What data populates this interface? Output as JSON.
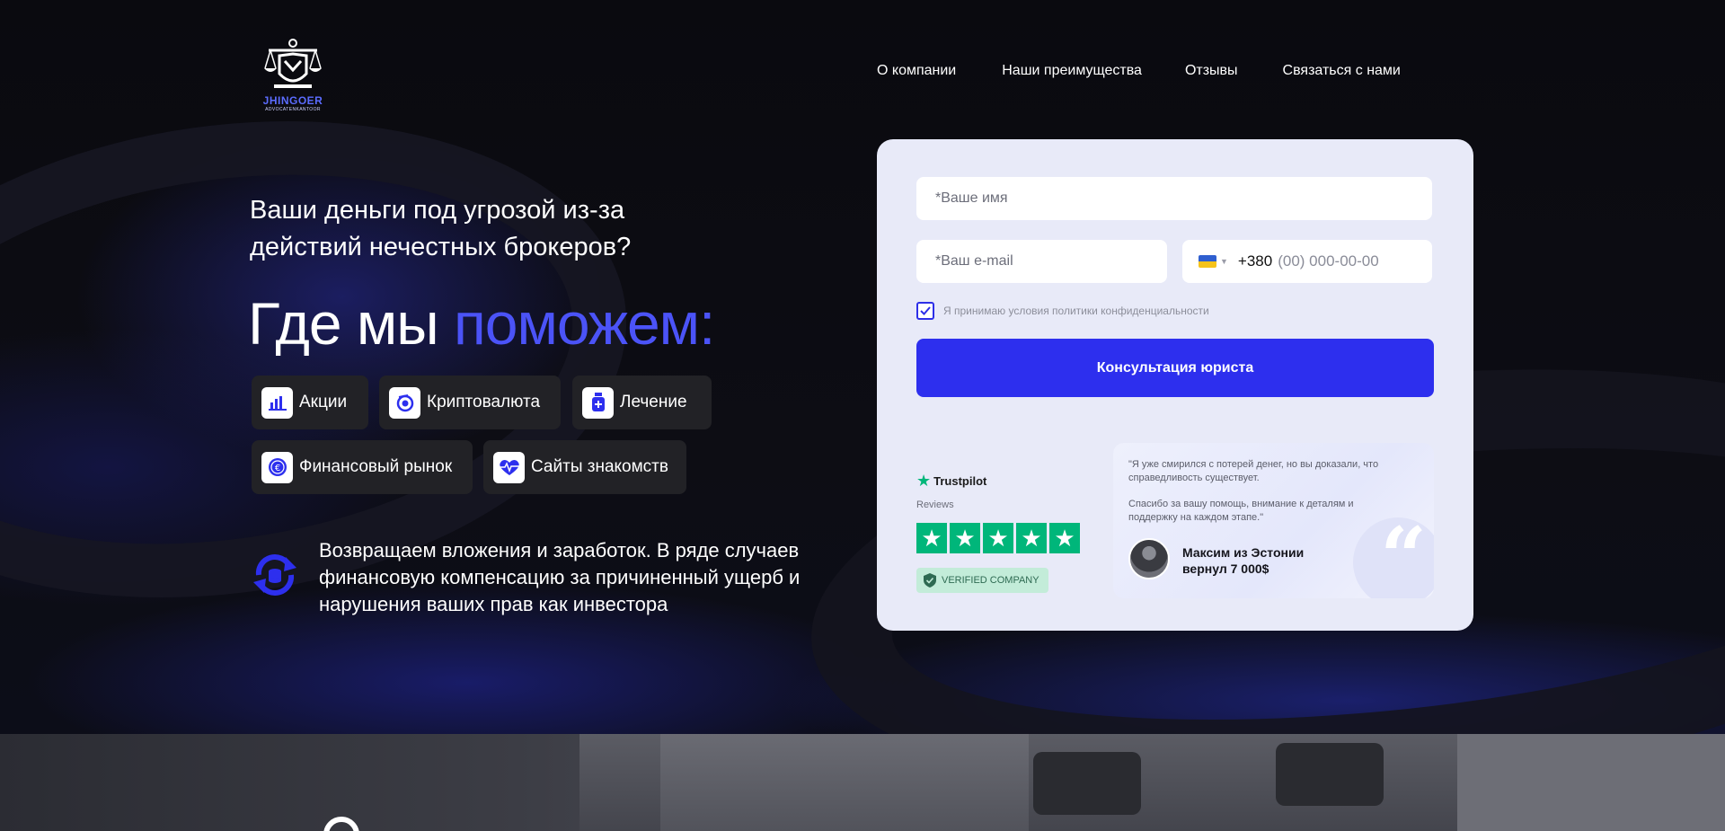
{
  "brand": {
    "name": "JHINGOER",
    "tagline": "ADVOCATENKANTOOR",
    "accent_color": "#4b53f7"
  },
  "nav": {
    "items": [
      {
        "label": "О компании"
      },
      {
        "label": "Наши преимущества"
      },
      {
        "label": "Отзывы"
      },
      {
        "label": "Связаться с нами"
      }
    ]
  },
  "hero": {
    "subtitle": "Ваши деньги под угрозой из-за действий нечестных брокеров?",
    "headline_prefix": "Где мы ",
    "headline_accent": "поможем:",
    "chips": [
      {
        "label": "Акции",
        "icon": "chart-bars-icon"
      },
      {
        "label": "Криптовалюта",
        "icon": "crypto-coin-icon"
      },
      {
        "label": "Лечение",
        "icon": "medicine-bottle-icon"
      },
      {
        "label": "Финансовый рынок",
        "icon": "euro-coin-icon"
      },
      {
        "label": "Сайты знакомств",
        "icon": "heart-pulse-icon"
      }
    ],
    "benefit_text": "Возвращаем вложения и заработок. В ряде случаев финансовую компенсацию за причиненный ущерб и нарушения ваших прав как инвестора"
  },
  "form": {
    "name_placeholder": "*Ваше имя",
    "email_placeholder": "*Ваш e-mail",
    "phone_code": "+380",
    "phone_placeholder": "(00) 000-00-00",
    "consent_text": "Я принимаю условия политики конфиденциальности",
    "consent_checked": true,
    "submit_label": "Консультация юриста",
    "submit_color": "#2d2fee"
  },
  "trustpilot": {
    "label": "Trustpilot",
    "reviews_label": "Reviews",
    "rating": 5,
    "max_rating": 5,
    "verified_label": "VERIFIED COMPANY",
    "star_color": "#00b67a"
  },
  "review": {
    "text_1": "\"Я уже смирился с потерей денег, но вы доказали, что справедливость существует.",
    "text_2": "Спасибо за вашу помощь, внимание к деталям и поддержку на каждом этапе.\"",
    "author_line_1": "Максим из Эстонии",
    "author_line_2": "вернул 7 000$"
  }
}
